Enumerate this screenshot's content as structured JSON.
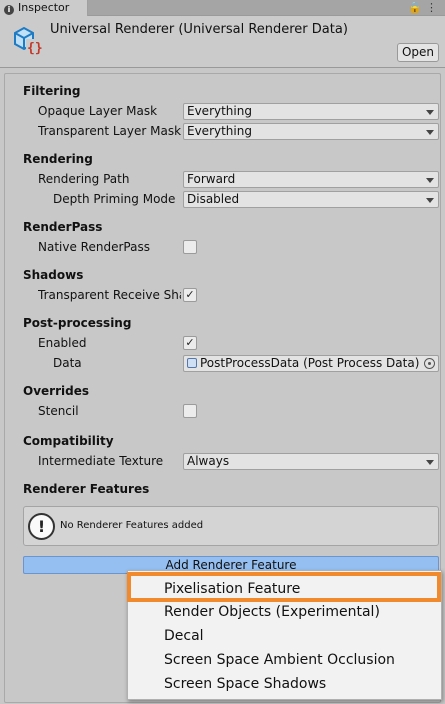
{
  "window": {
    "tab_label": "Inspector",
    "tab_icon": "info-icon",
    "toolbar_icons": [
      "lock-icon",
      "more-vert-icon"
    ]
  },
  "header": {
    "title": "Universal Renderer (Universal Renderer Data)",
    "icon": "renderer-asset-icon",
    "open_label": "Open"
  },
  "sections": {
    "filtering": "Filtering",
    "rendering": "Rendering",
    "renderpass": "RenderPass",
    "shadows": "Shadows",
    "postprocessing": "Post-processing",
    "overrides": "Overrides",
    "compatibility": "Compatibility",
    "renderer_features": "Renderer Features"
  },
  "fields": {
    "opaque_layer_mask": {
      "label": "Opaque Layer Mask",
      "value": "Everything"
    },
    "transparent_layer_mask": {
      "label": "Transparent Layer Mask",
      "value": "Everything"
    },
    "rendering_path": {
      "label": "Rendering Path",
      "value": "Forward"
    },
    "depth_priming_mode": {
      "label": "Depth Priming Mode",
      "value": "Disabled"
    },
    "native_renderpass": {
      "label": "Native RenderPass",
      "checked": false
    },
    "transparent_receive_shadows": {
      "label": "Transparent Receive Shadows",
      "checked": true
    },
    "pp_enabled": {
      "label": "Enabled",
      "checked": true
    },
    "pp_data": {
      "label": "Data",
      "value": "PostProcessData (Post Process Data)"
    },
    "stencil": {
      "label": "Stencil",
      "checked": false
    },
    "intermediate_texture": {
      "label": "Intermediate Texture",
      "value": "Always"
    }
  },
  "help_message": "No Renderer Features added",
  "add_feature_label": "Add Renderer Feature",
  "dropdown_menu": {
    "items": [
      "Pixelisation Feature",
      "Render Objects (Experimental)",
      "Decal",
      "Screen Space Ambient Occlusion",
      "Screen Space Shadows"
    ],
    "highlighted": "Pixelisation Feature",
    "highlight_color": "#f08a2c"
  },
  "colors": {
    "accent_button": "#95bff0",
    "panel_bg": "#c8c8c8"
  }
}
